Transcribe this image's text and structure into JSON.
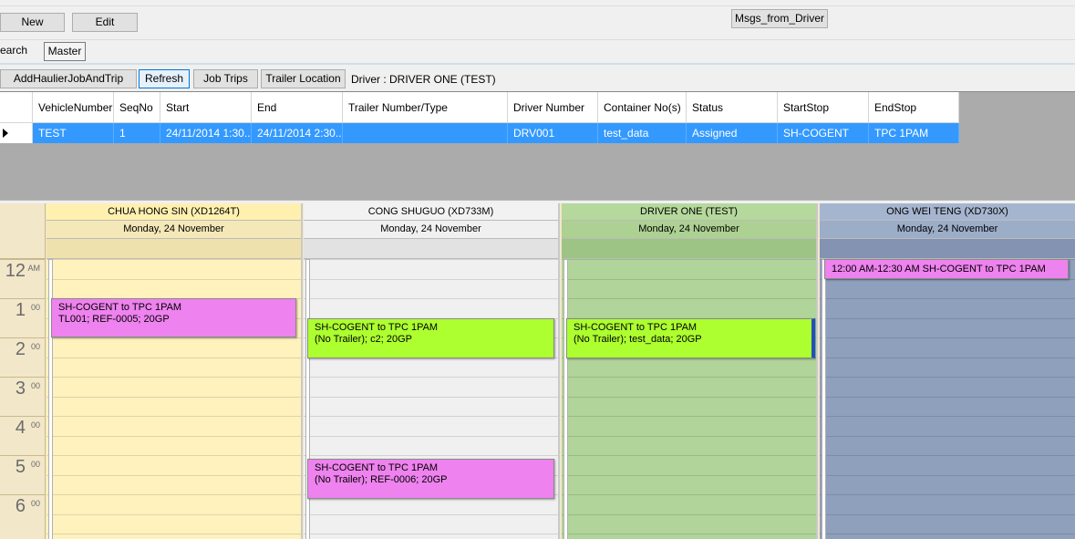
{
  "toolbar": {
    "new_label": "New",
    "edit_label": "Edit",
    "msgs_label": "Msgs_from_Driver"
  },
  "tabs": {
    "search_label": "Search",
    "master_label": "Master"
  },
  "actions": {
    "add_label": "AddHaulierJobAndTrip",
    "refresh_label": "Refresh",
    "jobtrips_label": "Job Trips",
    "trailer_label": "Trailer Location",
    "driver_text": "Driver : DRIVER ONE (TEST)"
  },
  "grid": {
    "columns": [
      "VehicleNumber",
      "SeqNo",
      "Start",
      "End",
      "Trailer Number/Type",
      "Driver Number",
      "Container No(s)",
      "Status",
      "StartStop",
      "EndStop"
    ],
    "row": [
      "TEST",
      "1",
      "24/11/2014 1:30...",
      "24/11/2014 2:30...",
      "",
      "DRV001",
      "test_data",
      "Assigned",
      "SH-COGENT",
      "TPC 1PAM"
    ]
  },
  "times": [
    {
      "h": "12",
      "m": "AM"
    },
    {
      "h": "1",
      "m": "00"
    },
    {
      "h": "2",
      "m": "00"
    },
    {
      "h": "3",
      "m": "00"
    },
    {
      "h": "4",
      "m": "00"
    },
    {
      "h": "5",
      "m": "00"
    },
    {
      "h": "6",
      "m": "00"
    }
  ],
  "resources": [
    {
      "name": "CHUA HONG SIN (XD1264T)",
      "date": "Monday, 24 November",
      "colors": {
        "bg": "#fff2bd",
        "head": "#fff0b0",
        "date": "#f5e8b8",
        "allday": "#efe1ae"
      },
      "appt": {
        "line1": "SH-COGENT to TPC 1PAM",
        "line2": "TL001; REF-0005; 20GP",
        "color": "#ee82ee"
      }
    },
    {
      "name": "CONG SHUGUO (XD733M)",
      "date": "Monday, 24 November",
      "colors": {
        "bg": "#f0f0f0",
        "head": "#f2f2f2",
        "date": "#f0f0f0",
        "allday": "#e2e2e2"
      },
      "appts": [
        {
          "line1": "SH-COGENT to TPC 1PAM",
          "line2": "(No Trailer); c2; 20GP",
          "color": "#adff2f"
        },
        {
          "line1": "SH-COGENT to TPC 1PAM",
          "line2": "(No Trailer); REF-0006; 20GP",
          "color": "#ee82ee"
        }
      ]
    },
    {
      "name": "DRIVER ONE (TEST)",
      "date": "Monday, 24 November",
      "colors": {
        "bg": "#b0d499",
        "head": "#b5d89c",
        "date": "#add093",
        "allday": "#9dc485"
      },
      "appt": {
        "line1": "SH-COGENT to TPC 1PAM",
        "line2": "(No Trailer); test_data; 20GP",
        "color": "#adff2f"
      }
    },
    {
      "name": "ONG WEI TENG (XD730X)",
      "date": "Monday, 24 November",
      "colors": {
        "bg": "#8fa0bd",
        "head": "#a6b5cf",
        "date": "#9cadc8",
        "allday": "#8393b1"
      },
      "appt": {
        "line1": "12:00 AM-12:30 AM SH-COGENT to TPC 1PAM",
        "color": "#ee82ee"
      }
    }
  ]
}
